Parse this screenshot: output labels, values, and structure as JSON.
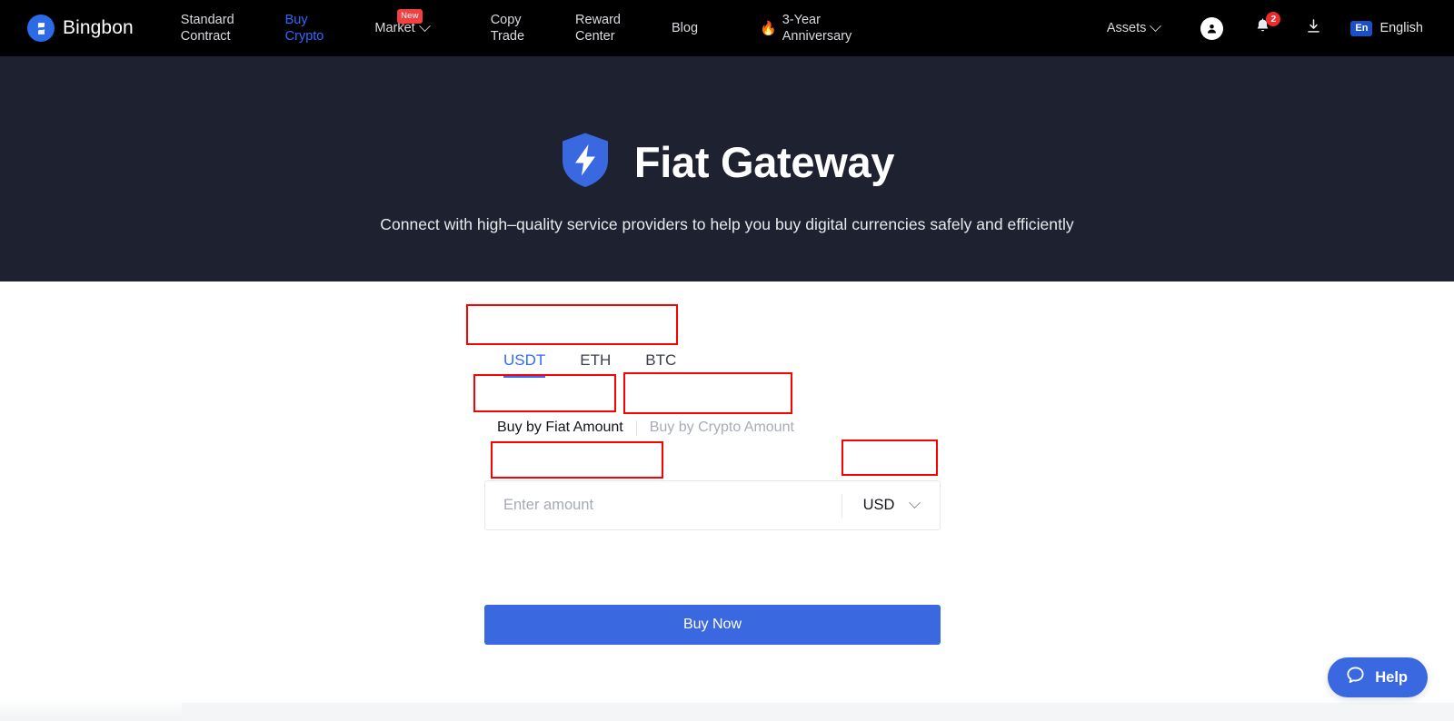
{
  "navbar": {
    "brand": {
      "name": "Bingbon",
      "icon": "bingbon-logo-icon"
    },
    "links": [
      {
        "label": "Standard\nContract",
        "accent": false,
        "chevron": false,
        "badge": null,
        "emoji": null
      },
      {
        "label": "Buy\nCrypto",
        "accent": true,
        "chevron": false,
        "badge": null,
        "emoji": null
      },
      {
        "label": "Market",
        "accent": false,
        "chevron": true,
        "badge": "New",
        "emoji": null
      },
      {
        "label": "Copy\nTrade",
        "accent": false,
        "chevron": false,
        "badge": null,
        "emoji": null
      },
      {
        "label": "Reward\nCenter",
        "accent": false,
        "chevron": false,
        "badge": null,
        "emoji": null
      },
      {
        "label": "Blog",
        "accent": false,
        "chevron": false,
        "badge": null,
        "emoji": null
      },
      {
        "label": "3-Year\nAnniversary",
        "accent": false,
        "chevron": false,
        "badge": null,
        "emoji": "🔥"
      }
    ],
    "assets": {
      "label": "Assets",
      "chevron": true
    },
    "account_icon": "user-avatar-icon",
    "notifications": {
      "icon": "bell-icon",
      "count": "2"
    },
    "download_icon": "download-icon",
    "language": {
      "chip": "En",
      "name": "English",
      "chevron": true
    }
  },
  "hero": {
    "icon": "shield-lightning-icon",
    "title": "Fiat Gateway",
    "subtitle": "Connect with high–quality service providers to help you buy digital currencies safely and efficiently"
  },
  "panel": {
    "coin_tabs": [
      {
        "label": "USDT",
        "active": true
      },
      {
        "label": "ETH",
        "active": false
      },
      {
        "label": "BTC",
        "active": false
      }
    ],
    "modes": [
      {
        "label": "Buy by Fiat Amount",
        "active": true
      },
      {
        "label": "Buy by Crypto Amount",
        "active": false
      }
    ],
    "amount": {
      "value": "",
      "placeholder": "Enter amount"
    },
    "currency": {
      "selected": "USD",
      "chevron_icon": "chevron-down-icon"
    },
    "submit_label": "Buy Now"
  },
  "help": {
    "label": "Help",
    "icon": "chat-bubble-icon"
  },
  "colors": {
    "navbar_bg": "#000000",
    "hero_bg": "#1e2130",
    "accent_blue": "#2f6bff",
    "button_blue": "#3a68e0",
    "badge_red": "#f02a2a",
    "annotation_red": "#ff0000"
  }
}
